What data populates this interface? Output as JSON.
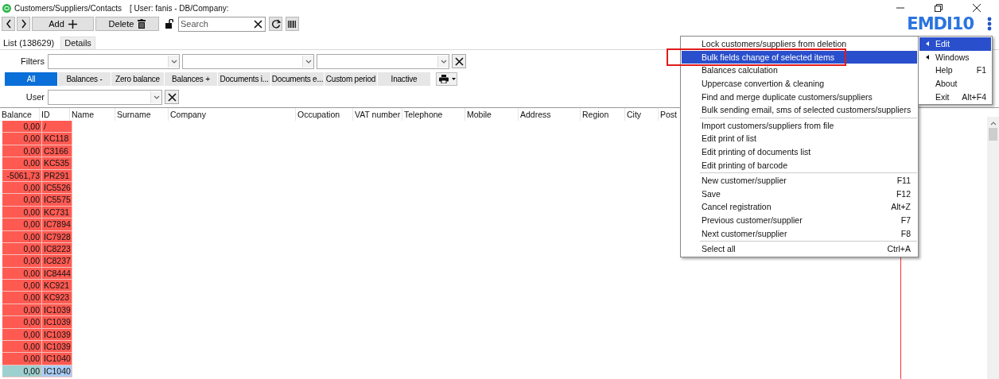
{
  "window": {
    "title": "Customers/Suppliers/Contacts",
    "user_info": "[ User: fanis - DB/Company:"
  },
  "logo": "EMDI10",
  "toolbar": {
    "add": "Add",
    "delete": "Delete",
    "search": {
      "placeholder": "Search"
    }
  },
  "tabs": [
    {
      "label": "List (138629)",
      "selected": true
    },
    {
      "label": "Details",
      "selected": false
    }
  ],
  "filters": {
    "label": "Filters"
  },
  "quick_filters": [
    {
      "label": "All",
      "selected": true
    },
    {
      "label": "Balances -",
      "selected": false
    },
    {
      "label": "Zero balance",
      "selected": false
    },
    {
      "label": "Balances +",
      "selected": false
    },
    {
      "label": "Documents i...",
      "selected": false
    },
    {
      "label": "Documents e...",
      "selected": false
    },
    {
      "label": "Custom period",
      "selected": false
    },
    {
      "label": "Inactive",
      "selected": false
    }
  ],
  "user_filter": {
    "label": "User"
  },
  "table": {
    "columns": [
      "Balance",
      "ID",
      "Name",
      "Surname",
      "Company",
      "Occupation",
      "VAT number",
      "Telephone",
      "Mobile",
      "Address",
      "Region",
      "City",
      "Post"
    ],
    "rows": [
      {
        "balance": "0,00",
        "id": "/",
        "color": "#ff5a52",
        "selected": false
      },
      {
        "balance": "0,00",
        "id": "KC118",
        "color": "#ff5a52",
        "selected": false
      },
      {
        "balance": "0,00",
        "id": "C3166",
        "color": "#ff5a52",
        "selected": false
      },
      {
        "balance": "0,00",
        "id": "KC535",
        "color": "#ff5a52",
        "selected": false
      },
      {
        "balance": "-5061,73",
        "id": "PR291",
        "color": "#ff5a52",
        "selected": false
      },
      {
        "balance": "0,00",
        "id": "IC5526",
        "color": "#ff5a52",
        "selected": false
      },
      {
        "balance": "0,00",
        "id": "IC5575",
        "color": "#ff5a52",
        "selected": false
      },
      {
        "balance": "0,00",
        "id": "KC731",
        "color": "#ff5a52",
        "selected": false
      },
      {
        "balance": "0,00",
        "id": "IC7894",
        "color": "#ff5a52",
        "selected": false
      },
      {
        "balance": "0,00",
        "id": "IC7928",
        "color": "#ff5a52",
        "selected": false
      },
      {
        "balance": "0,00",
        "id": "IC8223",
        "color": "#ff5a52",
        "selected": false
      },
      {
        "balance": "0,00",
        "id": "IC8237",
        "color": "#ff5a52",
        "selected": false
      },
      {
        "balance": "0,00",
        "id": "IC8444",
        "color": "#ff5a52",
        "selected": false
      },
      {
        "balance": "0,00",
        "id": "KC921",
        "color": "#ff5a52",
        "selected": false
      },
      {
        "balance": "0,00",
        "id": "KC923",
        "color": "#ff5a52",
        "selected": false
      },
      {
        "balance": "0,00",
        "id": "IC1039",
        "color": "#ff5a52",
        "selected": false
      },
      {
        "balance": "0,00",
        "id": "IC1039",
        "color": "#ff5a52",
        "selected": false
      },
      {
        "balance": "0,00",
        "id": "IC1039",
        "color": "#ff5a52",
        "selected": false
      },
      {
        "balance": "0,00",
        "id": "IC1039",
        "color": "#ff5a52",
        "selected": false
      },
      {
        "balance": "0,00",
        "id": "IC1040",
        "color": "#ff5a52",
        "selected": false
      },
      {
        "balance": "0,00",
        "id": "IC1040",
        "color": "#9ed0cf",
        "selected": true
      }
    ]
  },
  "context_menu": {
    "groups": [
      [
        {
          "label": "Lock customers/suppliers from deletion",
          "selected": false
        },
        {
          "label": "Bulk fields change of selected items",
          "selected": true
        },
        {
          "label": "Balances calculation",
          "selected": false
        },
        {
          "label": "Uppercase convertion & cleaning",
          "selected": false
        },
        {
          "label": "Find and merge duplicate customers/suppliers",
          "selected": false
        },
        {
          "label": "Bulk sending email, sms of selected customers/suppliers",
          "selected": false
        }
      ],
      [
        {
          "label": "Import customers/suppliers from file",
          "selected": false
        },
        {
          "label": "Edit print of list",
          "selected": false
        },
        {
          "label": "Edit printing of documents list",
          "selected": false
        },
        {
          "label": "Edit printing of barcode",
          "selected": false
        }
      ],
      [
        {
          "label": "New customer/supplier",
          "shortcut": "F11",
          "selected": false
        },
        {
          "label": "Save",
          "shortcut": "F12",
          "selected": false
        },
        {
          "label": "Cancel registration",
          "shortcut": "Alt+Z",
          "selected": false
        },
        {
          "label": "Previous customer/supplier",
          "shortcut": "F7",
          "selected": false
        },
        {
          "label": "Next customer/supplier",
          "shortcut": "F8",
          "selected": false
        }
      ],
      [
        {
          "label": "Select all",
          "shortcut": "Ctrl+A",
          "selected": false
        }
      ]
    ]
  },
  "main_menu": [
    {
      "label": "Edit",
      "submenu": true,
      "selected": true
    },
    {
      "label": "Windows",
      "submenu": true,
      "selected": false
    },
    {
      "label": "Help",
      "shortcut": "F1",
      "submenu": false,
      "selected": false
    },
    {
      "label": "About",
      "submenu": false,
      "selected": false
    },
    {
      "label": "Exit",
      "shortcut": "Alt+F4",
      "submenu": false,
      "selected": false
    }
  ]
}
